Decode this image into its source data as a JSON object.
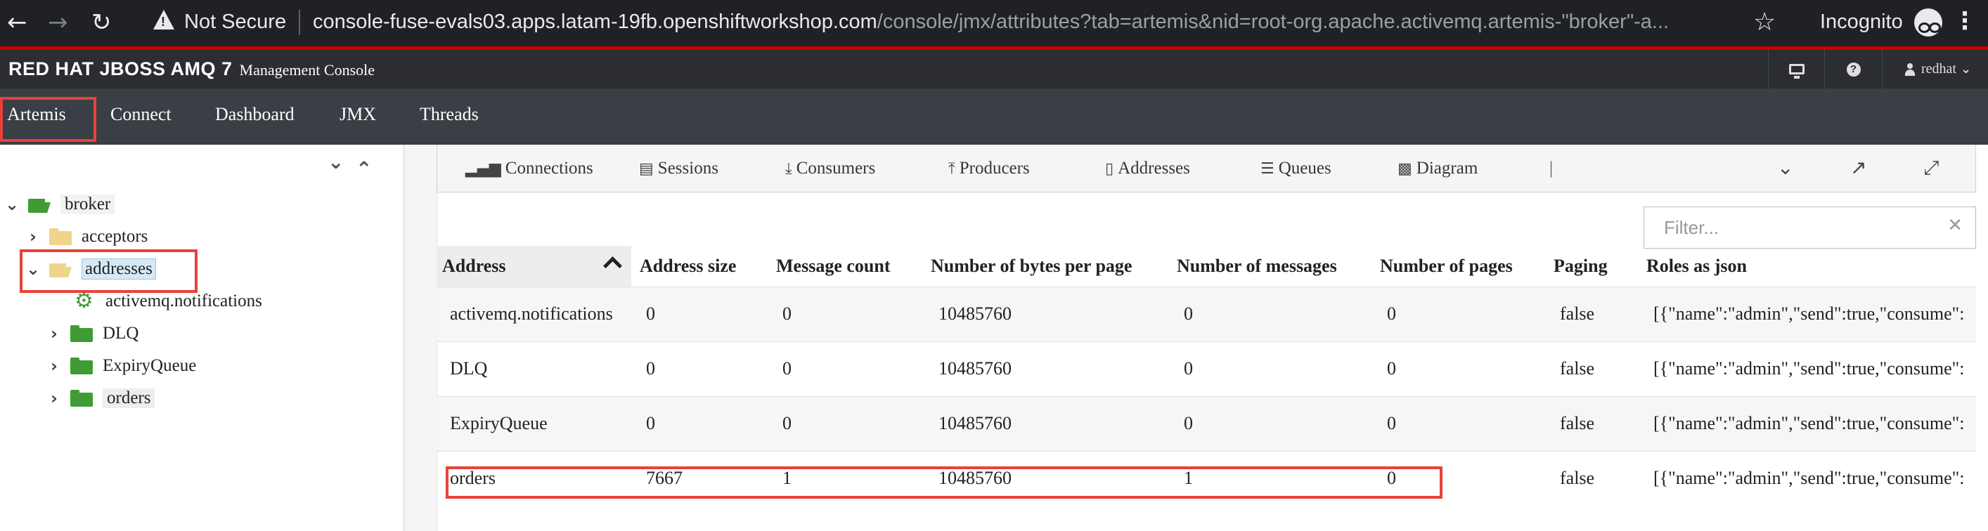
{
  "browser": {
    "not_secure": "Not Secure",
    "url_host": "console-fuse-evals03.apps.latam-19fb.openshiftworkshop.com",
    "url_path": "/console/jmx/attributes?tab=artemis&nid=root-org.apache.activemq.artemis-\"broker\"-a...",
    "incognito": "Incognito"
  },
  "header": {
    "logo": "RED HAT JBOSS AMQ 7",
    "subtitle": "Management Console",
    "user": "redhat"
  },
  "nav": {
    "items": [
      "Artemis",
      "Connect",
      "Dashboard",
      "JMX",
      "Threads"
    ]
  },
  "tree": {
    "root": "broker",
    "acceptors": "acceptors",
    "addresses": "addresses",
    "children": [
      "activemq.notifications",
      "DLQ",
      "ExpiryQueue",
      "orders"
    ]
  },
  "toolbar": {
    "tabs": [
      "Connections",
      "Sessions",
      "Consumers",
      "Producers",
      "Addresses",
      "Queues",
      "Diagram"
    ],
    "separator": "|"
  },
  "filter": {
    "placeholder": "Filter..."
  },
  "table": {
    "columns": [
      "Address",
      "Address size",
      "Message count",
      "Number of bytes per page",
      "Number of messages",
      "Number of pages",
      "Paging",
      "Roles as json"
    ],
    "rows": [
      [
        "activemq.notifications",
        "0",
        "0",
        "10485760",
        "0",
        "0",
        "false",
        "[{\"name\":\"admin\",\"send\":true,\"consume\":"
      ],
      [
        "DLQ",
        "0",
        "0",
        "10485760",
        "0",
        "0",
        "false",
        "[{\"name\":\"admin\",\"send\":true,\"consume\":"
      ],
      [
        "ExpiryQueue",
        "0",
        "0",
        "10485760",
        "0",
        "0",
        "false",
        "[{\"name\":\"admin\",\"send\":true,\"consume\":"
      ],
      [
        "orders",
        "7667",
        "1",
        "10485760",
        "1",
        "0",
        "false",
        "[{\"name\":\"admin\",\"send\":true,\"consume\":"
      ]
    ]
  },
  "colors": {
    "highlight": "#e8413a",
    "folder_green": "#3f9c35",
    "folder_tan": "#f0d48b",
    "brand_red": "#cc0000"
  }
}
